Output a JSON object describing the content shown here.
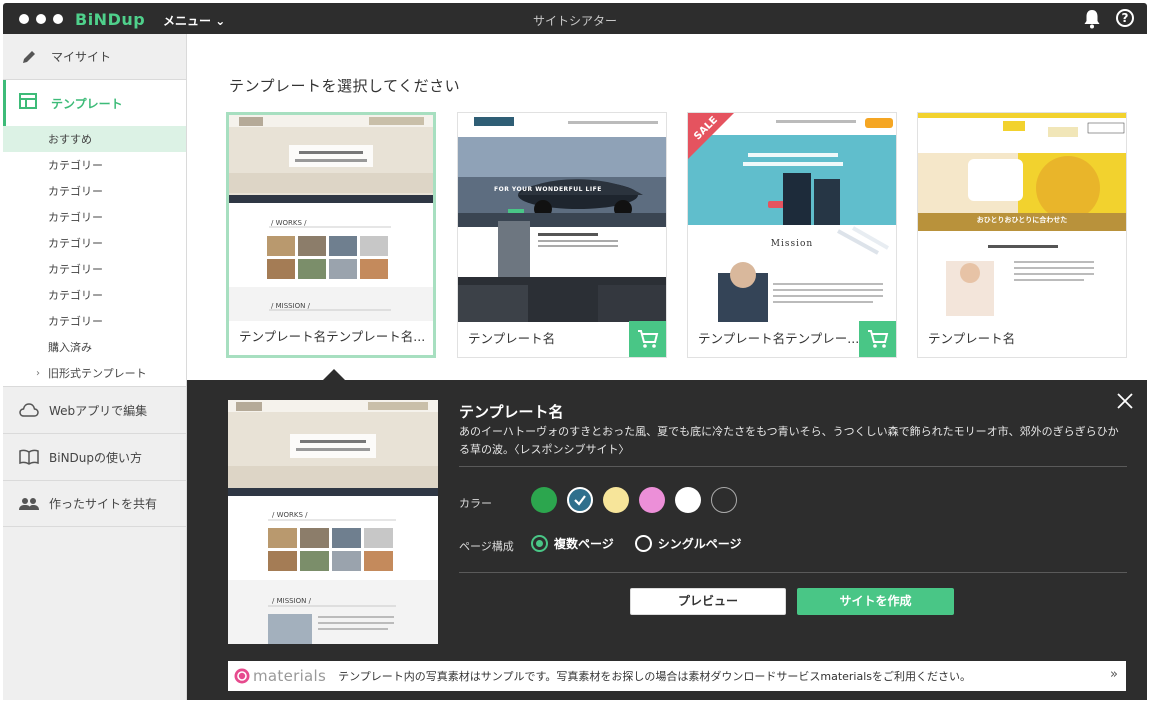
{
  "titlebar": {
    "brand": "BiNDup",
    "menu_label": "メニュー",
    "window_title": "サイトシアター"
  },
  "sidebar": {
    "my_site": "マイサイト",
    "templates": "テンプレート",
    "sub_items": [
      {
        "label": "おすすめ"
      },
      {
        "label": "カテゴリー"
      },
      {
        "label": "カテゴリー"
      },
      {
        "label": "カテゴリー"
      },
      {
        "label": "カテゴリー"
      },
      {
        "label": "カテゴリー"
      },
      {
        "label": "カテゴリー"
      },
      {
        "label": "カテゴリー"
      },
      {
        "label": "購入済み"
      },
      {
        "label": "旧形式テンプレート"
      }
    ],
    "web_app_edit": "Webアプリで編集",
    "how_to_use": "BiNDupの使い方",
    "share_site": "作ったサイトを共有"
  },
  "main": {
    "heading": "テンプレートを選択してください",
    "cards": [
      {
        "name": "テンプレート名テンプレート名...",
        "paid": false
      },
      {
        "name": "テンプレート名",
        "paid": true,
        "thumb_text": "FOR YOUR WONDERFUL  LIFE"
      },
      {
        "name": "テンプレート名テンプレー...",
        "paid": true,
        "badge": "SALE",
        "thumb_text": "Mission"
      },
      {
        "name": "テンプレート名",
        "paid": false,
        "thumb_text": "おひとりおひとりに合わせた"
      }
    ],
    "thumb1_sections": [
      "WORKS",
      "MISSION"
    ]
  },
  "detail": {
    "title": "テンプレート名",
    "description": "あのイーハトーヴォのすきとおった風、夏でも底に冷たさをもつ青いそら、うつくしい森で飾られたモリーオ市、郊外のぎらぎらひかる草の波。〈レスポンシブサイト〉",
    "color_label": "カラー",
    "colors": [
      "#2ca64e",
      "#2f6f8c",
      "#f7e59a",
      "#ec8fd8",
      "#ffffff",
      "#2d2d2d"
    ],
    "page_label": "ページ構成",
    "page_options": [
      "複数ページ",
      "シングルページ"
    ],
    "preview_button": "プレビュー",
    "create_button": "サイトを作成",
    "materials_logo": "materials",
    "materials_text": "テンプレート内の写真素材はサンプルです。写真素材をお探しの場合は素材ダウンロードサービスmaterialsをご利用ください。",
    "materials_arrow": "»"
  },
  "accent_color": "#49c686"
}
